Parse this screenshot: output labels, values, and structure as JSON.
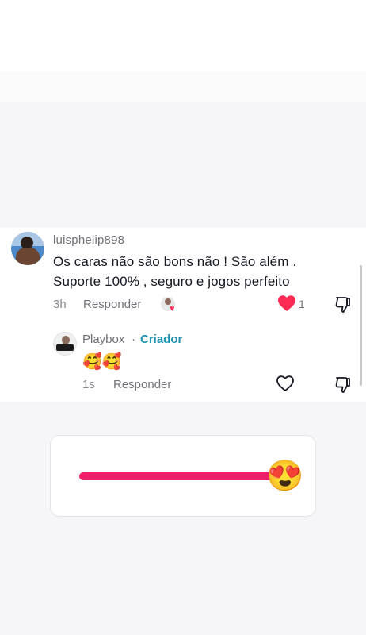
{
  "comment": {
    "username": "luisphelip898",
    "text_line1": "Os caras não são bons não ! São além .",
    "text_line2": "Suporte 100% , seguro e jogos perfeito",
    "time": "3h",
    "reply_label": "Responder",
    "like_count": "1",
    "liked": true
  },
  "creator_reply": {
    "name": "Playbox",
    "separator": "·",
    "tag": "Criador",
    "text": "🥰🥰",
    "time": "1s",
    "reply_label": "Responder"
  },
  "slider": {
    "value": 1.0,
    "thumb_emoji": "😍",
    "track_color": "#ef1f6b"
  },
  "colors": {
    "like_red": "#fe2c55",
    "creator_tag": "#1f94b4"
  },
  "icons": {
    "like": "heart-filled-icon",
    "like_outline": "heart-outline-icon",
    "dislike": "thumbs-down-icon"
  }
}
